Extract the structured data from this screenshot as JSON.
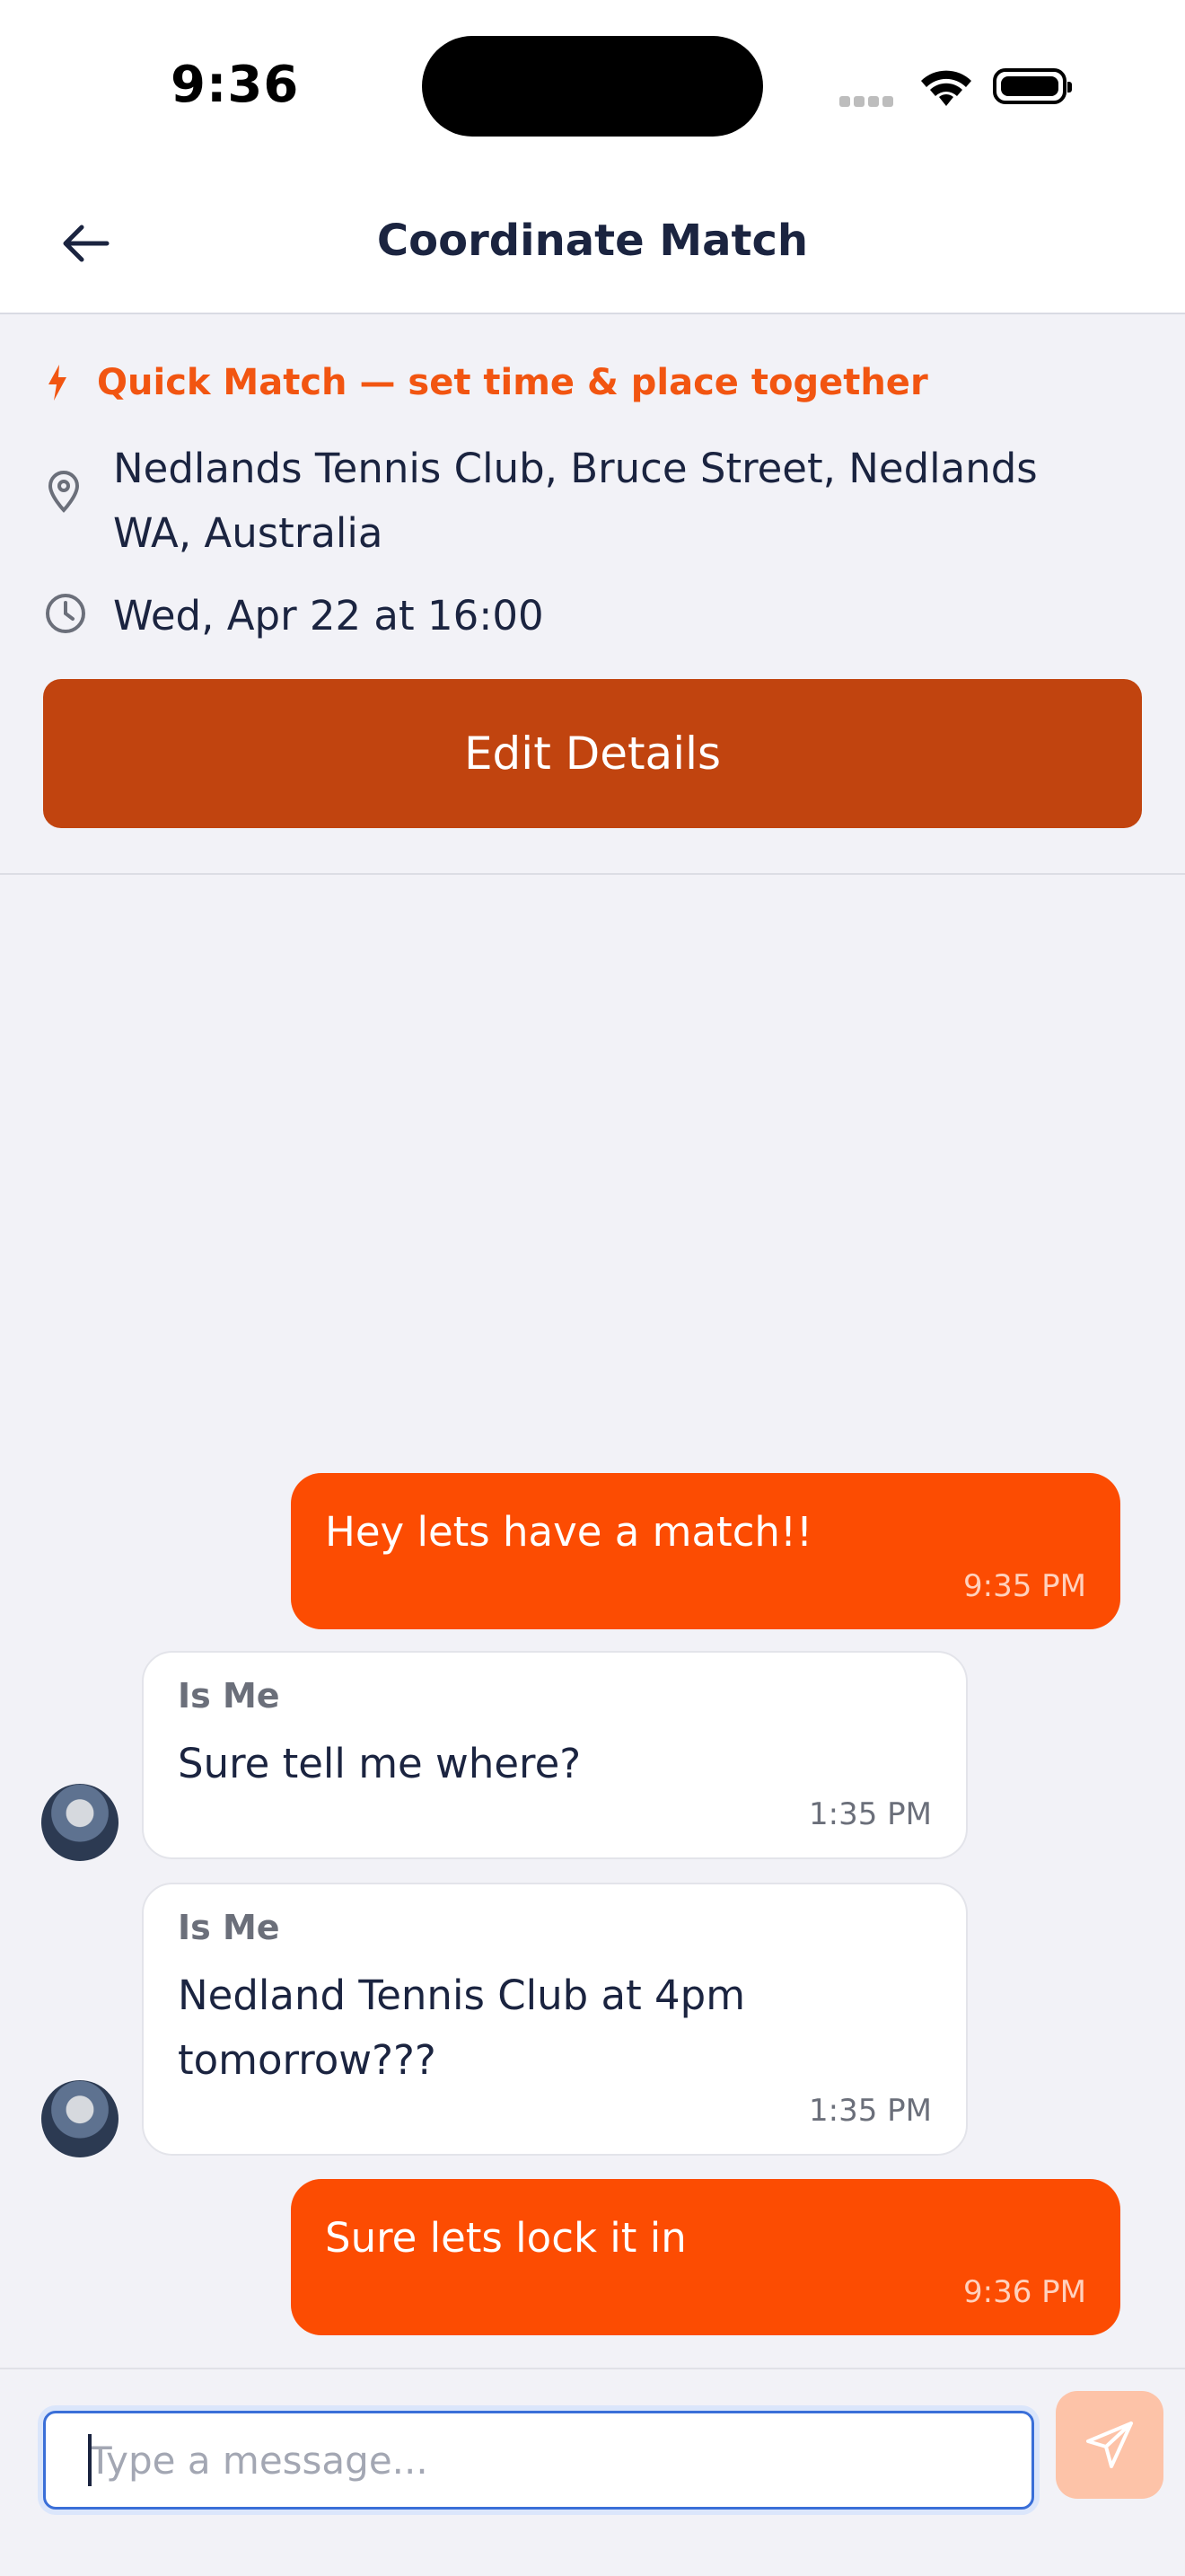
{
  "status_bar": {
    "time": "9:36"
  },
  "header": {
    "title": "Coordinate Match",
    "back_icon": "arrow-left-icon"
  },
  "match": {
    "quick_label": "Quick Match — set time & place together",
    "location": "Nedlands Tennis Club, Bruce Street, Nedlands WA, Australia",
    "datetime": "Wed, Apr 22 at 16:00",
    "edit_label": "Edit Details"
  },
  "messages": [
    {
      "direction": "outgoing",
      "text": "Hey lets have a match!!",
      "time": "9:35 PM"
    },
    {
      "direction": "incoming",
      "sender": "Is Me",
      "text": "Sure tell me where?",
      "time": "1:35 PM"
    },
    {
      "direction": "incoming",
      "sender": "Is Me",
      "text": "Nedland Tennis Club at 4pm tomorrow???",
      "time": "1:35 PM"
    },
    {
      "direction": "outgoing",
      "text": "Sure lets lock it in",
      "time": "9:36 PM"
    }
  ],
  "composer": {
    "placeholder": "Type a message...",
    "value": ""
  },
  "colors": {
    "accent": "#fc4c02",
    "edit_button": "#c1440f",
    "quick_label": "#f25511",
    "send_button_disabled": "#fdc3a8",
    "text_primary": "#1b2440"
  }
}
